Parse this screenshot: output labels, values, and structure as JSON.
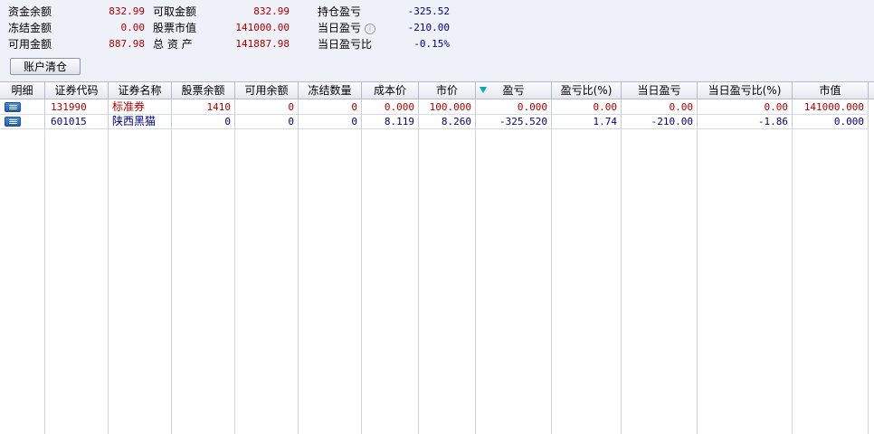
{
  "summary": {
    "fund_balance_label": "资金余额",
    "fund_balance": "832.99",
    "withdrawable_label": "可取金额",
    "withdrawable": "832.99",
    "position_pnl_label": "持仓盈亏",
    "position_pnl": "-325.52",
    "frozen_label": "冻结金额",
    "frozen": "0.00",
    "stock_value_label": "股票市值",
    "stock_value": "141000.00",
    "daily_pnl_label": "当日盈亏",
    "daily_pnl": "-210.00",
    "available_label": "可用金额",
    "available": "887.98",
    "total_assets_label": "总 资 产",
    "total_assets": "141887.98",
    "daily_pnl_ratio_label": "当日盈亏比",
    "daily_pnl_ratio": "-0.15%",
    "clear_button": "账户清仓",
    "info_icon": "info-circle-icon"
  },
  "table": {
    "columns": [
      "明细",
      "证券代码",
      "证券名称",
      "股票余额",
      "可用余额",
      "冻结数量",
      "成本价",
      "市价",
      "盈亏",
      "盈亏比(%)",
      "当日盈亏",
      "当日盈亏比(%)",
      "市值"
    ],
    "sorted_column_icon": "sort-desc-icon",
    "rows": [
      {
        "code": "131990",
        "name": "标准券",
        "balance": "1410",
        "available": "0",
        "frozen": "0",
        "cost": "0.000",
        "price": "100.000",
        "pnl": "0.000",
        "pnl_ratio": "0.00",
        "daily_pnl": "0.00",
        "daily_pnl_ratio": "0.00",
        "market_value": "141000.000"
      },
      {
        "code": "601015",
        "name": "陕西黑猫",
        "balance": "0",
        "available": "0",
        "frozen": "0",
        "cost": "8.119",
        "price": "8.260",
        "pnl": "-325.520",
        "pnl_ratio": "1.74",
        "daily_pnl": "-210.00",
        "daily_pnl_ratio": "-1.86",
        "market_value": "0.000"
      }
    ]
  },
  "colors": {
    "positive": "#b00000",
    "negative": "#000080",
    "header_bg": "#e4e8ef",
    "summary_bg": "#eef1f7"
  }
}
